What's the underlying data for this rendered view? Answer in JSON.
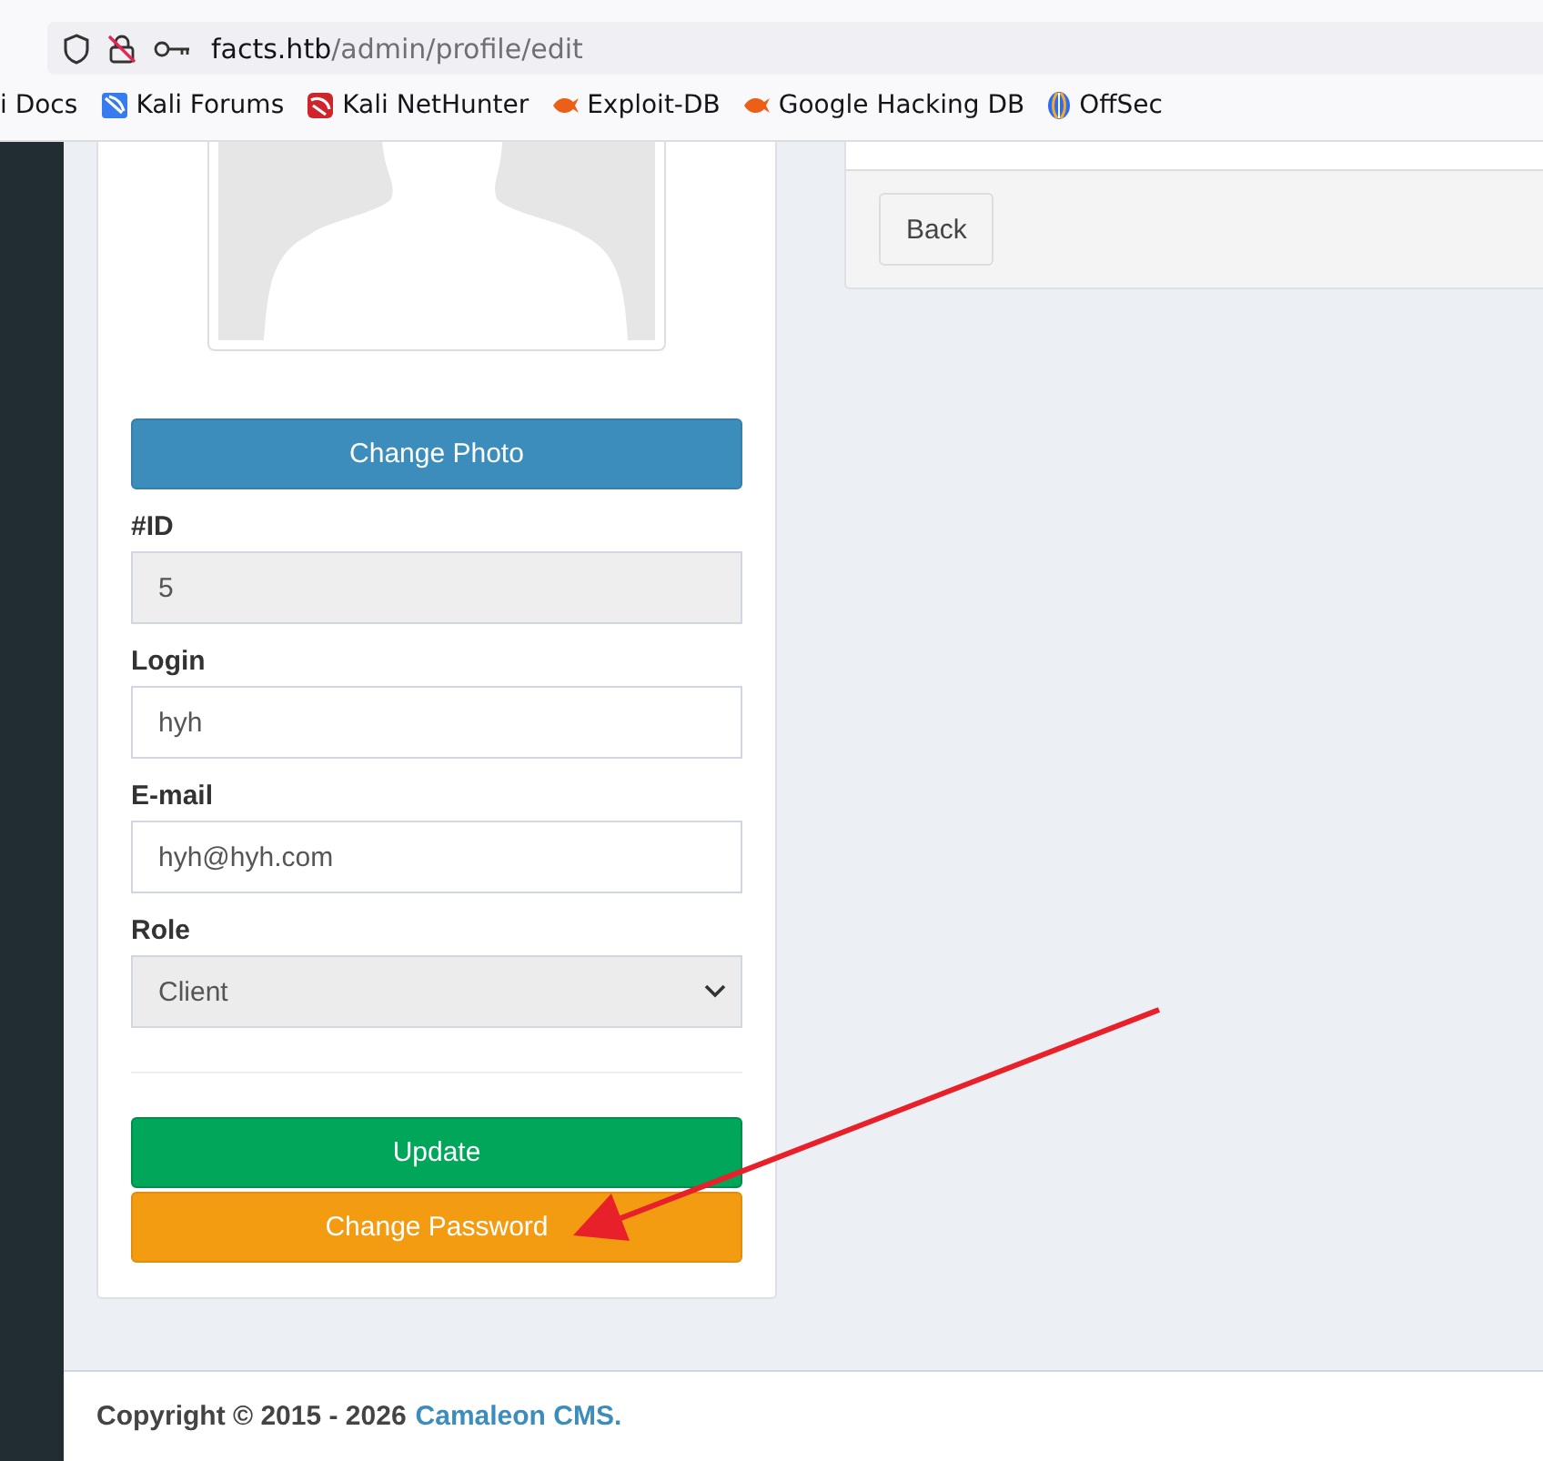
{
  "browser": {
    "url_host": "facts.htb",
    "url_path": "/admin/profile/edit",
    "bookmarks": [
      {
        "label": "i Docs",
        "kind": "none"
      },
      {
        "label": "Kali Forums",
        "kind": "forum"
      },
      {
        "label": "Kali NetHunter",
        "kind": "nethunter"
      },
      {
        "label": "Exploit-DB",
        "kind": "flame"
      },
      {
        "label": "Google Hacking DB",
        "kind": "flame"
      },
      {
        "label": "OffSec",
        "kind": "offsec"
      }
    ]
  },
  "profile": {
    "change_photo": "Change Photo",
    "fields": [
      {
        "label": "#ID",
        "value": "5",
        "kind": "readonly"
      },
      {
        "label": "Login",
        "value": "hyh",
        "kind": "text"
      },
      {
        "label": "E-mail",
        "value": "hyh@hyh.com",
        "kind": "text"
      },
      {
        "label": "Role",
        "value": "Client",
        "kind": "select"
      }
    ],
    "buttons": [
      {
        "label": "Update",
        "kind": "success"
      },
      {
        "label": "Change Password",
        "kind": "warning"
      }
    ]
  },
  "side_panel": {
    "back": "Back"
  },
  "footer": {
    "text": "Copyright © 2015 - 2026",
    "link": "Camaleon CMS."
  }
}
